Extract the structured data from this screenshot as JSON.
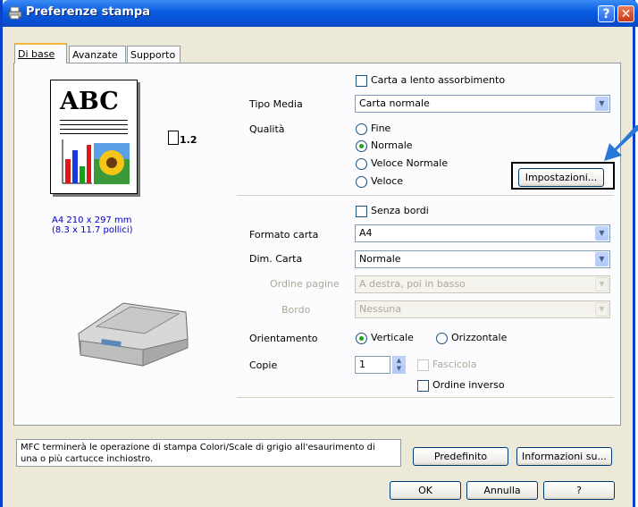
{
  "window": {
    "title": "Preferenze stampa",
    "help_glyph": "?",
    "close_glyph": "✕"
  },
  "tabs": [
    {
      "label": "Di base"
    },
    {
      "label": "Avanzate"
    },
    {
      "label": "Supporto"
    }
  ],
  "preview": {
    "abc": "ABC",
    "paper_size_line1": "A4 210 x 297 mm",
    "paper_size_line2": "(8.3 x 11.7 pollici)",
    "page_count": "1.2"
  },
  "slow_dry": {
    "label": "Carta a lento assorbimento",
    "checked": false
  },
  "media": {
    "label": "Tipo Media",
    "value": "Carta normale"
  },
  "quality": {
    "label": "Qualità",
    "options": [
      "Fine",
      "Normale",
      "Veloce Normale",
      "Veloce"
    ],
    "selected": "Normale"
  },
  "settings_button": "Impostazioni...",
  "borderless": {
    "label": "Senza bordi",
    "checked": false
  },
  "paper_size": {
    "label": "Formato carta",
    "value": "A4"
  },
  "page_size": {
    "label": "Dim. Carta",
    "value": "Normale"
  },
  "page_order": {
    "label": "Ordine pagine",
    "value": "A destra, poi in basso"
  },
  "border": {
    "label": "Bordo",
    "value": "Nessuna"
  },
  "orientation": {
    "label": "Orientamento",
    "portrait": "Verticale",
    "landscape": "Orizzontale",
    "selected": "Verticale"
  },
  "copies": {
    "label": "Copie",
    "value": "1",
    "collate": "Fascicola",
    "reverse": "Ordine inverso"
  },
  "message": {
    "line1": "MFC terminerà le operazione di stampa Colori/Scale di grigio all'esaurimento di",
    "line2": "una o più cartucce inchiostro."
  },
  "buttons": {
    "default": "Predefinito",
    "about": "Informazioni su...",
    "ok": "OK",
    "cancel": "Annulla",
    "help": "?"
  },
  "colors": {
    "title_bar": "#0a5be0",
    "face": "#ece9d8",
    "arrow": "#2878d8"
  }
}
